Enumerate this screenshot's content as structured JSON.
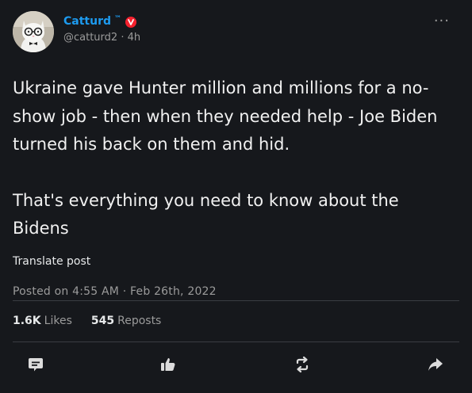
{
  "author": {
    "display_name": "Catturd",
    "tm": "™",
    "handle_time": "@catturd2 · 4h",
    "more_label": "···"
  },
  "post": {
    "paragraphs": [
      "Ukraine gave Hunter million and millions for a no-show job - then when they needed help - Joe Biden turned his back on them and hid.",
      "That's everything you need to know about the Bidens"
    ],
    "translate_label": "Translate post",
    "timestamp": "Posted on 4:55 AM · Feb 26th, 2022"
  },
  "stats": {
    "likes_count": "1.6K",
    "likes_label": "Likes",
    "reposts_count": "545",
    "reposts_label": "Reposts"
  },
  "actions": {
    "icons": [
      "comment-icon",
      "like-icon",
      "repost-icon",
      "share-icon"
    ]
  },
  "colors": {
    "background": "#16181c",
    "accent": "#1d9bf0",
    "badge": "#f4212e",
    "muted": "#9b9b9b",
    "text": "#e7e9ea"
  }
}
